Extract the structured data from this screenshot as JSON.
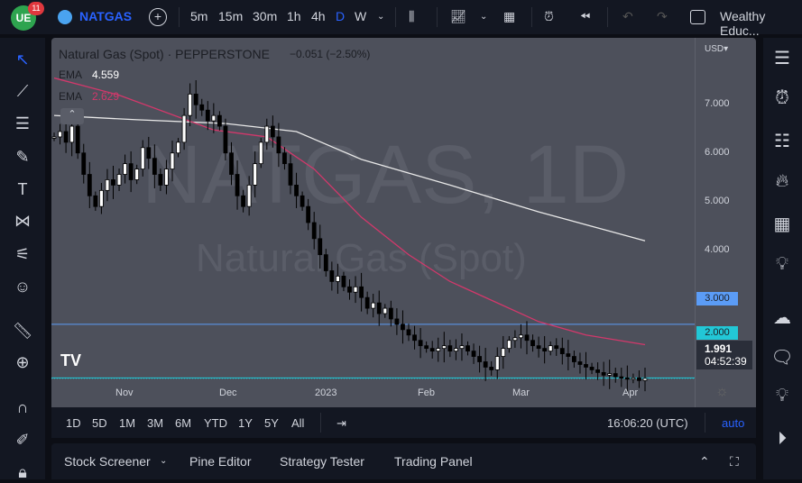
{
  "header": {
    "notification_count": "11",
    "symbol": "NATGAS",
    "intervals": [
      "5m",
      "15m",
      "30m",
      "1h",
      "4h",
      "D",
      "W"
    ],
    "active_interval": "D",
    "layout_name": "Wealthy Educ..."
  },
  "legend": {
    "title": "Natural Gas (Spot) · PEPPERSTONE",
    "change": "−0.051 (−2.50%)",
    "ema1_label": "EMA",
    "ema1_value": "4.559",
    "ema2_label": "EMA",
    "ema2_value": "2.629"
  },
  "watermark": {
    "line1": "NATGAS, 1D",
    "line2": "Natural Gas (Spot)"
  },
  "price_axis": {
    "currency": "USD▾",
    "ticks": [
      "7.000",
      "6.000",
      "5.000",
      "4.000"
    ],
    "line_3": "3.000",
    "line_2": "2.000",
    "last_price": "1.991",
    "countdown": "04:52:39"
  },
  "time_axis": [
    "Nov",
    "Dec",
    "2023",
    "Feb",
    "Mar",
    "Apr"
  ],
  "timeframes": [
    "1D",
    "5D",
    "1M",
    "3M",
    "6M",
    "YTD",
    "1Y",
    "5Y",
    "All"
  ],
  "clock": "16:06:20 (UTC)",
  "auto_label": "auto",
  "bottom_tabs": [
    "Stock Screener",
    "Pine Editor",
    "Strategy Tester",
    "Trading Panel"
  ],
  "colors": {
    "ema_white": "#e8e8e8",
    "ema_pink": "#d2386b",
    "line_3": "#5b9cf6",
    "line_2": "#22c7d6",
    "accent": "#2962ff"
  },
  "chart_data": {
    "type": "candlestick",
    "ylim": [
      1.45,
      8.35
    ],
    "closes": [
      6.5,
      6.6,
      6.4,
      6.7,
      6.2,
      5.8,
      5.4,
      5.2,
      5.5,
      5.7,
      5.6,
      5.8,
      6.0,
      5.7,
      5.9,
      6.3,
      6.1,
      5.8,
      5.6,
      5.9,
      6.2,
      6.4,
      6.9,
      7.3,
      7.1,
      7.0,
      6.8,
      6.9,
      6.7,
      6.2,
      5.8,
      5.4,
      5.2,
      5.6,
      6.0,
      6.4,
      6.7,
      6.5,
      6.2,
      6.0,
      5.6,
      5.4,
      5.2,
      4.9,
      4.6,
      4.3,
      4.0,
      3.8,
      3.9,
      3.7,
      3.6,
      3.7,
      3.5,
      3.3,
      3.4,
      3.2,
      3.3,
      3.1,
      3.0,
      2.9,
      2.8,
      2.7,
      2.6,
      2.55,
      2.5,
      2.55,
      2.6,
      2.5,
      2.55,
      2.6,
      2.5,
      2.4,
      2.3,
      2.2,
      2.15,
      2.4,
      2.55,
      2.7,
      2.75,
      2.8,
      2.7,
      2.6,
      2.55,
      2.5,
      2.6,
      2.55,
      2.45,
      2.4,
      2.3,
      2.25,
      2.2,
      2.15,
      2.1,
      2.05,
      2.08,
      2.02,
      2.0,
      1.98,
      2.0,
      1.95,
      1.99
    ],
    "ema_long": [
      [
        0,
        6.9
      ],
      [
        14,
        6.82
      ],
      [
        29,
        6.75
      ],
      [
        41,
        6.6
      ],
      [
        52,
        6.08
      ],
      [
        67,
        5.6
      ],
      [
        82,
        5.1
      ],
      [
        100,
        4.56
      ]
    ],
    "ema_short": [
      [
        0,
        7.6
      ],
      [
        11,
        7.28
      ],
      [
        27,
        6.63
      ],
      [
        36,
        6.5
      ],
      [
        44,
        5.9
      ],
      [
        52,
        5.0
      ],
      [
        60,
        4.3
      ],
      [
        67,
        3.8
      ],
      [
        75,
        3.4
      ],
      [
        82,
        3.05
      ],
      [
        90,
        2.8
      ],
      [
        100,
        2.62
      ]
    ]
  }
}
